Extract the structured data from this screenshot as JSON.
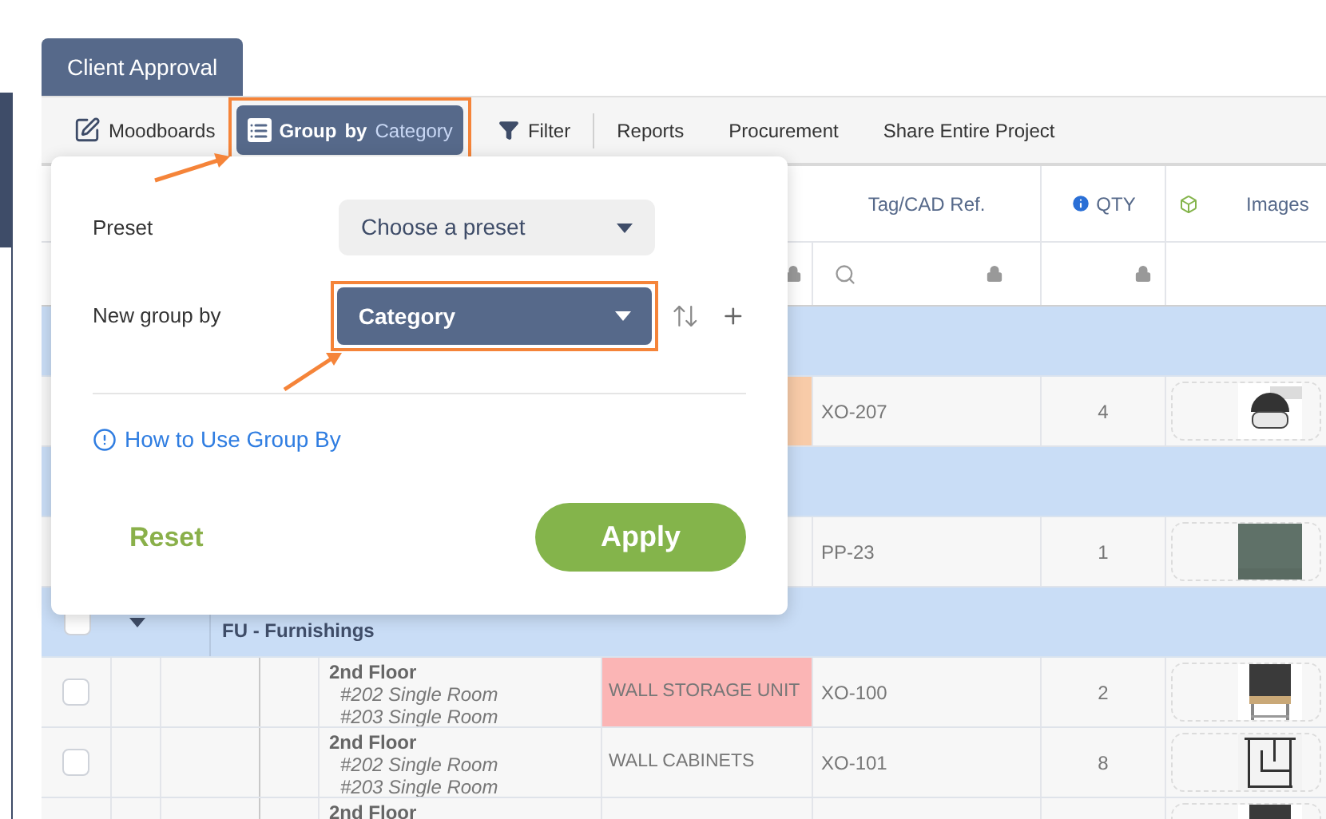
{
  "tab": {
    "label": "Client Approval",
    "selected": true
  },
  "toolbar": {
    "moodboards": "Moodboards",
    "group_by": {
      "label": "Group",
      "by": "by",
      "value": "Category",
      "highlighted": true
    },
    "filter": "Filter",
    "links": [
      "Reports",
      "Procurement",
      "Share Entire Project"
    ]
  },
  "columns": [
    {
      "kind": "name",
      "locked": true
    },
    {
      "kind": "tag",
      "title": "Tag/CAD Ref.",
      "search": true,
      "locked": true
    },
    {
      "kind": "qty",
      "title": "QTY",
      "locked": true
    },
    {
      "kind": "images",
      "title": "Images"
    }
  ],
  "rows": [
    {
      "kind": "group"
    },
    {
      "kind": "item",
      "color": "#f8cba8",
      "tag": "XO-207",
      "qty": "4",
      "image": {
        "kind": "picture"
      }
    },
    {
      "kind": "group"
    },
    {
      "kind": "item",
      "tag": "PP-23",
      "qty": "1",
      "image": {
        "kind": "picture"
      }
    },
    {
      "kind": "group",
      "value": "FU - Furnishings",
      "checked": false
    },
    {
      "kind": "item",
      "checked": false,
      "location": "2nd Floor",
      "rooms": [
        "#202 Single Room",
        "#203 Single Room"
      ],
      "name": "WALL STORAGE UNIT",
      "color": "#fbb5b5",
      "tag": "XO-100",
      "qty": "2",
      "image": {
        "kind": "picture"
      }
    },
    {
      "kind": "item",
      "checked": false,
      "location": "2nd Floor",
      "rooms": [
        "#202 Single Room",
        "#203 Single Room"
      ],
      "name": "WALL CABINETS",
      "tag": "XO-101",
      "qty": "8",
      "image": {
        "kind": "picture"
      }
    },
    {
      "kind": "item",
      "location": "2nd Floor",
      "image": {
        "kind": "picture"
      }
    }
  ],
  "group_by_panel": {
    "preset": {
      "label": "Preset",
      "placeholder": "Choose a preset"
    },
    "new_group": {
      "label": "New group by",
      "value": "Category",
      "highlighted": true
    },
    "help_link": "How to Use Group By",
    "reset": "Reset",
    "apply": "Apply"
  }
}
